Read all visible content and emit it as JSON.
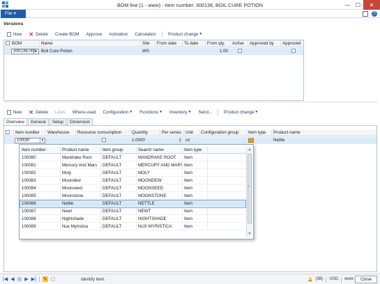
{
  "window": {
    "title": "BOM line (1 - www) - Item number: 300138, BOIL CURE POTION",
    "minimize": "—",
    "maximize": "☐",
    "close": "✕"
  },
  "menu": {
    "file_label": "File",
    "file_caret": "▾"
  },
  "versions": {
    "section_title": "Versions",
    "toolbar": {
      "new": "New",
      "delete": "Delete",
      "create_bom": "Create BOM",
      "approve": "Approve",
      "activation": "Activation",
      "calculation": "Calculation",
      "product_change": "Product change"
    },
    "columns": [
      "BOM",
      "Name",
      "Site",
      "From date",
      "To date",
      "From qty.",
      "Active",
      "Approved by",
      "Approved"
    ],
    "row": {
      "bom": "300138.001",
      "name": "Boil Cure Potion",
      "site": "WS",
      "from_date": "",
      "to_date": "",
      "from_qty": "1.00",
      "approved_by": ""
    }
  },
  "lines": {
    "toolbar": {
      "new": "New",
      "delete": "Delete",
      "lines": "Lines",
      "where_used": "Where-used",
      "configuration": "Configuration",
      "functions": "Functions",
      "inventory": "Inventory",
      "send": "Send...",
      "product_change": "Product change"
    },
    "tabs": [
      "Overview",
      "General",
      "Setup",
      "Dimension"
    ],
    "columns": [
      "Item number",
      "Warehouse",
      "Resource consumption",
      "Quantity",
      "Per series",
      "Unit",
      "Configuration group",
      "Item type",
      "Product name"
    ],
    "row": {
      "item_number": "10008°",
      "warehouse": "",
      "quantity": "1.0000",
      "per_series": "1",
      "unit": "oz",
      "config_group": "",
      "product_name": "Nettle"
    }
  },
  "lookup": {
    "columns": [
      "Item number",
      "Product name",
      "Item group",
      "Search name",
      "Item type"
    ],
    "rows": [
      {
        "item": "100080",
        "product": "Mandrake Root",
        "group": "DEFAULT",
        "search": "MANDRAKE ROOT",
        "type": "Item"
      },
      {
        "item": "100081",
        "product": "Mercury And Mars",
        "group": "DEFAULT",
        "search": "MERCURY AND MARS",
        "type": "Item"
      },
      {
        "item": "100082",
        "product": "Moly",
        "group": "DEFAULT",
        "search": "MOLY",
        "type": "Item"
      },
      {
        "item": "100083",
        "product": "Moondew",
        "group": "DEFAULT",
        "search": "MOONDEW",
        "type": "Item"
      },
      {
        "item": "100084",
        "product": "Moonseed",
        "group": "DEFAULT",
        "search": "MOONSEED",
        "type": "Item"
      },
      {
        "item": "100085",
        "product": "Moonstone",
        "group": "DEFAULT",
        "search": "MOONSTONE",
        "type": "Item"
      },
      {
        "item": "100086",
        "product": "Nettle",
        "group": "DEFAULT",
        "search": "NETTLE",
        "type": "Item"
      },
      {
        "item": "100087",
        "product": "Newt",
        "group": "DEFAULT",
        "search": "NEWT",
        "type": "Item"
      },
      {
        "item": "100088",
        "product": "Nightshade",
        "group": "DEFAULT",
        "search": "NIGHTSHADE",
        "type": "Item"
      },
      {
        "item": "100089",
        "product": "Nux Myristica",
        "group": "DEFAULT",
        "search": "NUX MYRISTICA",
        "type": "Item"
      }
    ],
    "highlighted_item": "100086"
  },
  "status": {
    "text": "Identify item.",
    "notifications": "(38)",
    "currency": "USD",
    "company": "www",
    "close_button": "Close"
  },
  "colors": {
    "accent": "#1f5ea8",
    "close": "#c7463a",
    "selection": "#dcebf8"
  }
}
